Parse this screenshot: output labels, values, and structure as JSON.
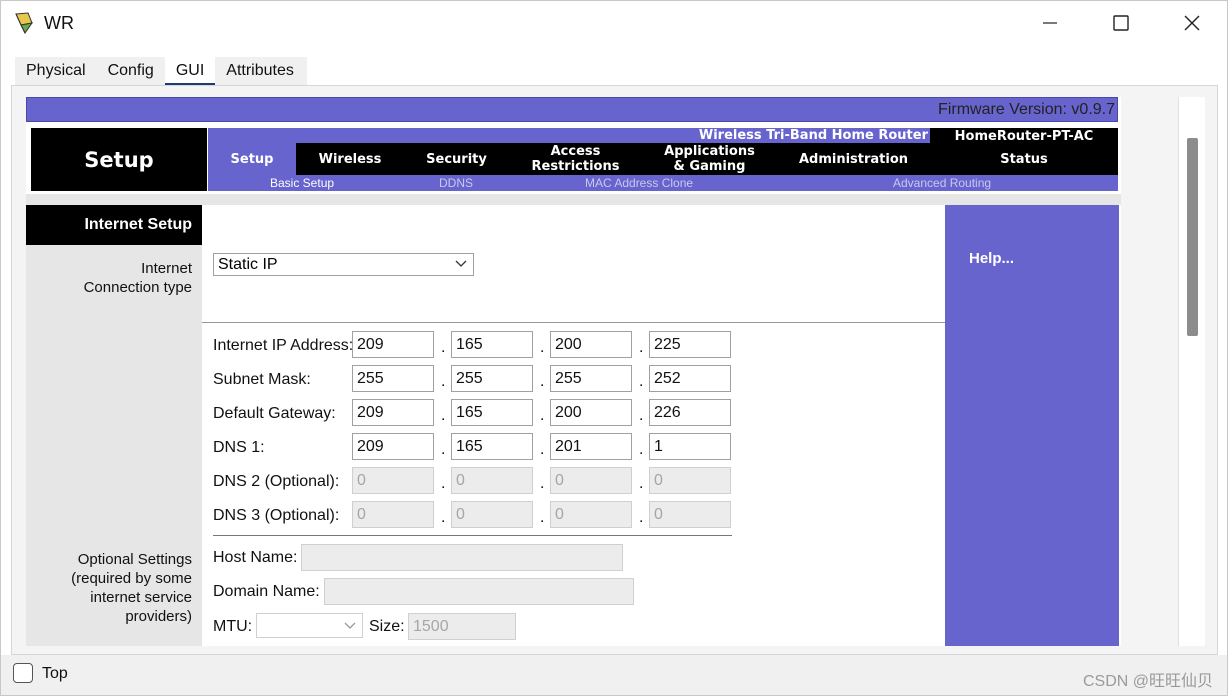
{
  "window": {
    "title": "WR"
  },
  "tabs": [
    "Physical",
    "Config",
    "GUI",
    "Attributes"
  ],
  "firmware": "Firmware Version: v0.9.7",
  "header": {
    "section": "Setup",
    "model": "Wireless Tri-Band Home Router",
    "router": "HomeRouter-PT-AC",
    "nav": [
      "Setup",
      "Wireless",
      "Security",
      "Access\nRestrictions",
      "Applications\n& Gaming",
      "Administration",
      "Status"
    ],
    "subnav": [
      "Basic Setup",
      "DDNS",
      "MAC Address Clone",
      "Advanced Routing"
    ]
  },
  "internet_setup": {
    "heading": "Internet Setup",
    "conn_label_1": "Internet",
    "conn_label_2": "Connection type",
    "conn_type": "Static IP",
    "optional_1": "Optional Settings",
    "optional_2": "(required by some",
    "optional_3": "internet service",
    "optional_4": "providers)"
  },
  "fields": {
    "ip": {
      "label": "Internet IP Address:",
      "octets": [
        "209",
        "165",
        "200",
        "225"
      ]
    },
    "mask": {
      "label": "Subnet Mask:",
      "octets": [
        "255",
        "255",
        "255",
        "252"
      ]
    },
    "gateway": {
      "label": "Default Gateway:",
      "octets": [
        "209",
        "165",
        "200",
        "226"
      ]
    },
    "dns1": {
      "label": "DNS 1:",
      "octets": [
        "209",
        "165",
        "201",
        "1"
      ]
    },
    "dns2": {
      "label": "DNS 2 (Optional):",
      "octets": [
        "0",
        "0",
        "0",
        "0"
      ]
    },
    "dns3": {
      "label": "DNS 3 (Optional):",
      "octets": [
        "0",
        "0",
        "0",
        "0"
      ]
    },
    "dot": "."
  },
  "optional": {
    "host_label": "Host Name:",
    "domain_label": "Domain Name:",
    "mtu_label": "MTU:",
    "size_label": "Size:",
    "size_value": "1500"
  },
  "help": "Help...",
  "bottom": {
    "top_label": "Top",
    "watermark": "CSDN @旺旺仙贝"
  },
  "colors": {
    "accent": "#6764cd",
    "black": "#000000"
  }
}
